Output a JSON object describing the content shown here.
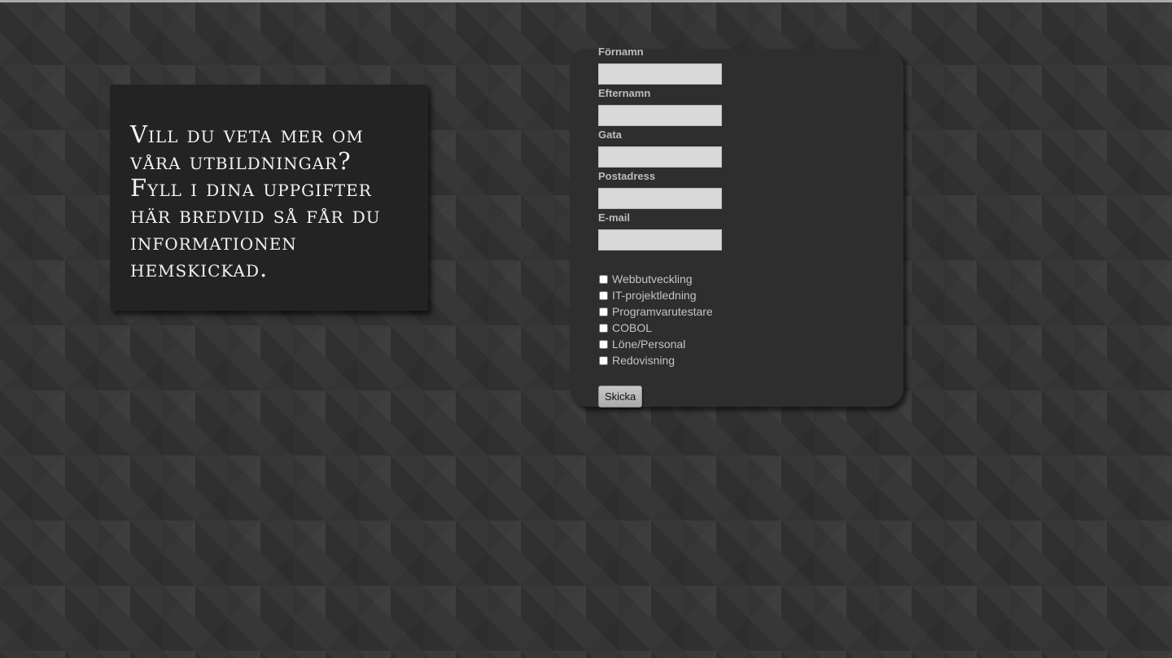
{
  "info": {
    "text": "Vill du veta mer om våra utbildningar? Fyll i dina uppgifter här bredvid så får du informationen hemskickad."
  },
  "form": {
    "fields": [
      {
        "label": "Förnamn",
        "value": ""
      },
      {
        "label": "Efternamn",
        "value": ""
      },
      {
        "label": "Gata",
        "value": ""
      },
      {
        "label": "Postadress",
        "value": ""
      },
      {
        "label": "E-mail",
        "value": ""
      }
    ],
    "courses": [
      "Webbutveckling",
      "IT-projektledning",
      "Programvarutestare",
      "COBOL",
      "Löne/Personal",
      "Redovisning"
    ],
    "submit_label": "Skicka"
  },
  "colors": {
    "background": "#333333",
    "card": "#2e2e2e",
    "info_box": "#232323",
    "input": "#d9d9d9"
  }
}
